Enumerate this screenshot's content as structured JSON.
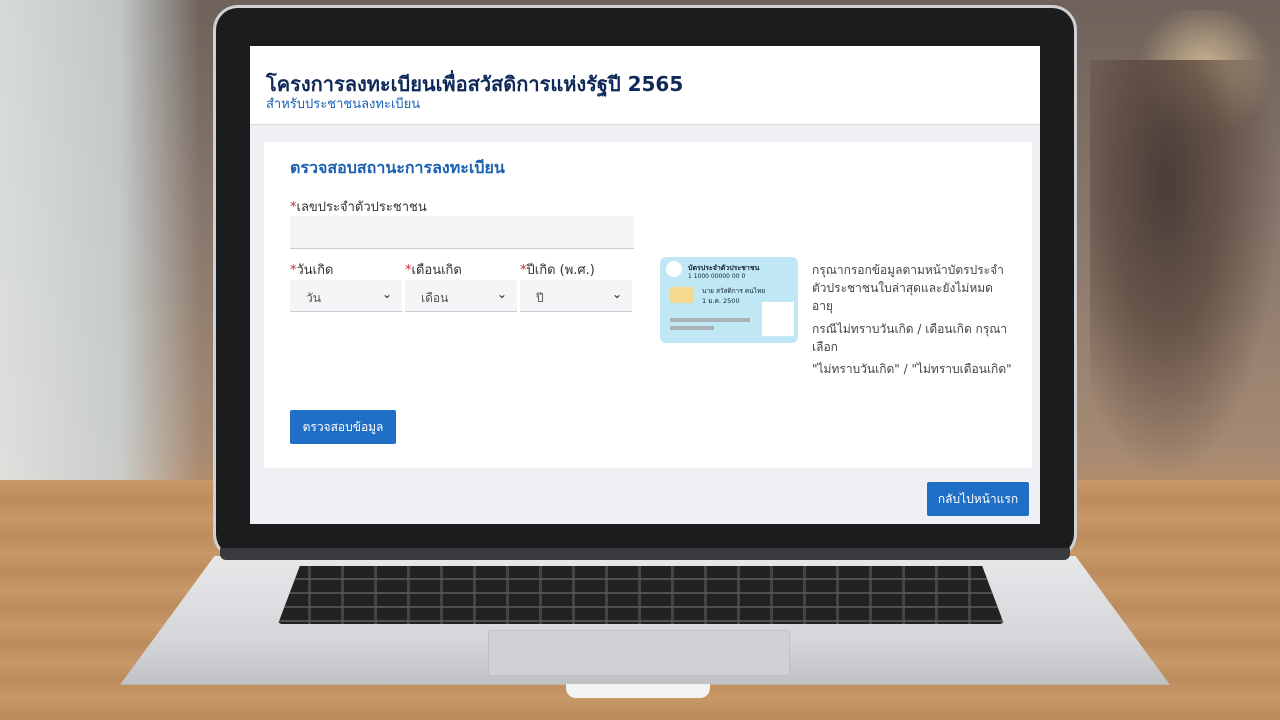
{
  "header": {
    "title": "โครงการลงทะเบียนเพื่อสวัสดิการแห่งรัฐปี 2565",
    "subtitle": "สำหรับประชาชนลงทะเบียน"
  },
  "form": {
    "title": "ตรวจสอบสถานะการลงทะเบียน",
    "required_mark": "*",
    "id_label": "เลขประจำตัวประชาชน",
    "id_value": "",
    "day_label": "วันเกิด",
    "day_value": "วัน",
    "month_label": "เดือนเกิด",
    "month_value": "เดือน",
    "year_label": "ปีเกิด (พ.ศ.)",
    "year_value": "ปี",
    "submit_label": "ตรวจสอบข้อมูล"
  },
  "id_card": {
    "title": "บัตรประจำตัวประชาชน",
    "number": "1 1000 00000 00 0",
    "name": "นาย สวัสดิการ คนไทย",
    "dob": "1 ม.ค. 2500"
  },
  "hints": {
    "line1": "กรุณากรอกข้อมูลตามหน้าบัตรประจำตัวประชาชนใบล่าสุดและยังไม่หมดอายุ",
    "line2": "กรณีไม่ทราบวันเกิด / เดือนเกิด กรุณาเลือก",
    "line3": "\"ไม่ทราบวันเกิด\" / \"ไม่ทราบเดือนเกิด\""
  },
  "footer": {
    "back_label": "กลับไปหน้าแรก"
  },
  "icons": {
    "select_chevron": "chevron-down-icon"
  },
  "colors": {
    "primary": "#1f6fc6",
    "title_navy": "#0f2a5a",
    "accent_blue": "#1a5fb0",
    "required_red": "#d0262f",
    "card_blue": "#bfe7f4"
  }
}
